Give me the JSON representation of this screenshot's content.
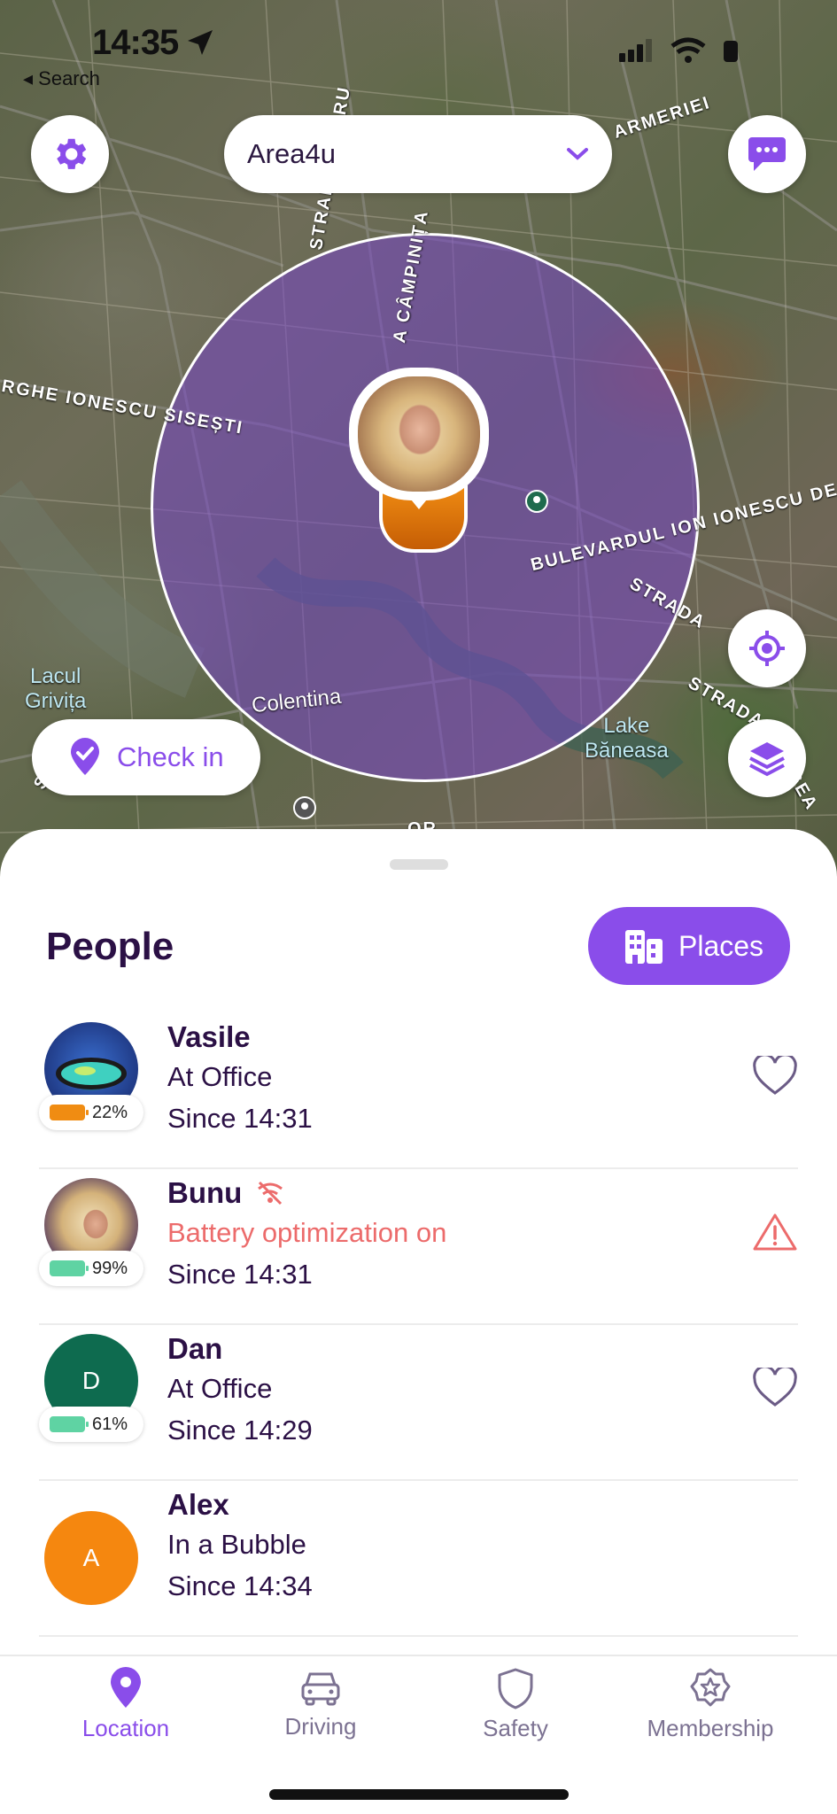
{
  "status_bar": {
    "time": "14:35",
    "back_label": "◂ Search"
  },
  "map": {
    "group_name": "Area4u",
    "labels": {
      "street_iezeru": "STRADA IEZERU",
      "street_campinita": "A CÂMPINIȚA",
      "street_ionescu": "RGHE IONESCU SISEȘTI",
      "street_bulevard": "BULEVARDUL ION IONESCU DE LA",
      "street_armeriei": "ARMERIEI",
      "street_strada_a": "STRADA",
      "street_strada_b": "STRADA",
      "street_bogea": "OGEA",
      "street_sta": "STRA",
      "street_or": "OR",
      "lake_grivita": "Lacul\nGrivița",
      "lake_baneasa": "Lake\nBăneasa",
      "colentina": "Colentina"
    },
    "check_in_label": "Check in"
  },
  "sheet": {
    "title": "People",
    "places_label": "Places",
    "people": [
      {
        "name": "Vasile",
        "status": "At Office",
        "since": "Since 14:31",
        "battery": "22%",
        "battery_level": 0.22,
        "battery_color": "#f08c12",
        "avatar_type": "photo-helmet",
        "icon": "heart-icon"
      },
      {
        "name": "Bunu",
        "status": "Battery optimization on",
        "since": "Since 14:31",
        "battery": "99%",
        "battery_level": 0.99,
        "battery_color": "#5fd3a3",
        "avatar_type": "photo-woman",
        "icon": "warning-icon",
        "name_icon": "wifi-off-icon"
      },
      {
        "name": "Dan",
        "status": "At Office",
        "since": "Since 14:29",
        "battery": "61%",
        "battery_level": 0.61,
        "battery_color": "#5fd3a3",
        "avatar_initial": "D",
        "avatar_color": "#0e6b4f",
        "icon": "heart-icon"
      },
      {
        "name": "Alex",
        "status": "In a Bubble",
        "since": "Since 14:34",
        "avatar_initial": "A",
        "avatar_color": "#f5870f"
      }
    ]
  },
  "tabs": [
    {
      "label": "Location",
      "icon": "location-pin-icon",
      "active": true
    },
    {
      "label": "Driving",
      "icon": "car-icon",
      "active": false
    },
    {
      "label": "Safety",
      "icon": "shield-icon",
      "active": false
    },
    {
      "label": "Membership",
      "icon": "star-badge-icon",
      "active": false
    }
  ],
  "colors": {
    "accent": "#8a4dea",
    "text_dark": "#2b1045",
    "warning": "#ec6b6b"
  }
}
